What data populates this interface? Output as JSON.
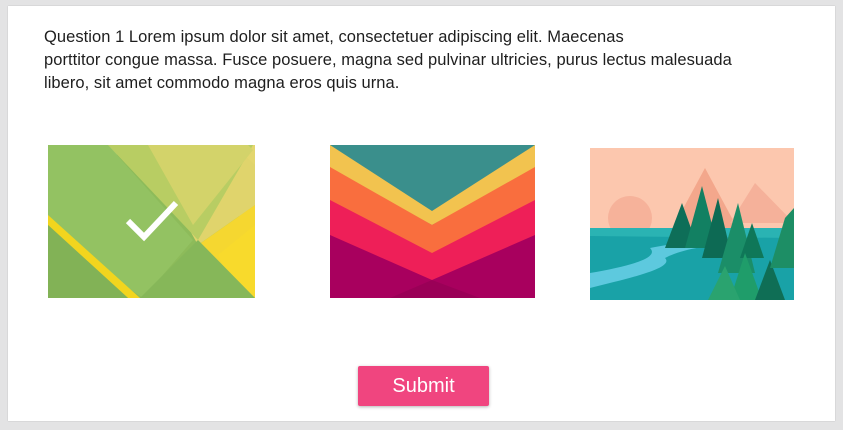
{
  "question": {
    "lines": [
      "Question 1 Lorem ipsum dolor sit amet, consectetuer adipiscing elit. Maecenas",
      "porttitor congue massa. Fusce posuere, magna sed pulvinar ultricies, purus lectus malesuada",
      "libero, sit amet commodo magna eros quis urna."
    ]
  },
  "options": [
    {
      "image": "green-yellow-geometric-image",
      "selected": true
    },
    {
      "image": "magenta-chevron-envelope-image",
      "selected": false
    },
    {
      "image": "forest-lake-landscape-image",
      "selected": false
    }
  ],
  "submit": {
    "label": "Submit"
  },
  "colors": {
    "accent": "#f0457f",
    "check": "#ffffff"
  }
}
